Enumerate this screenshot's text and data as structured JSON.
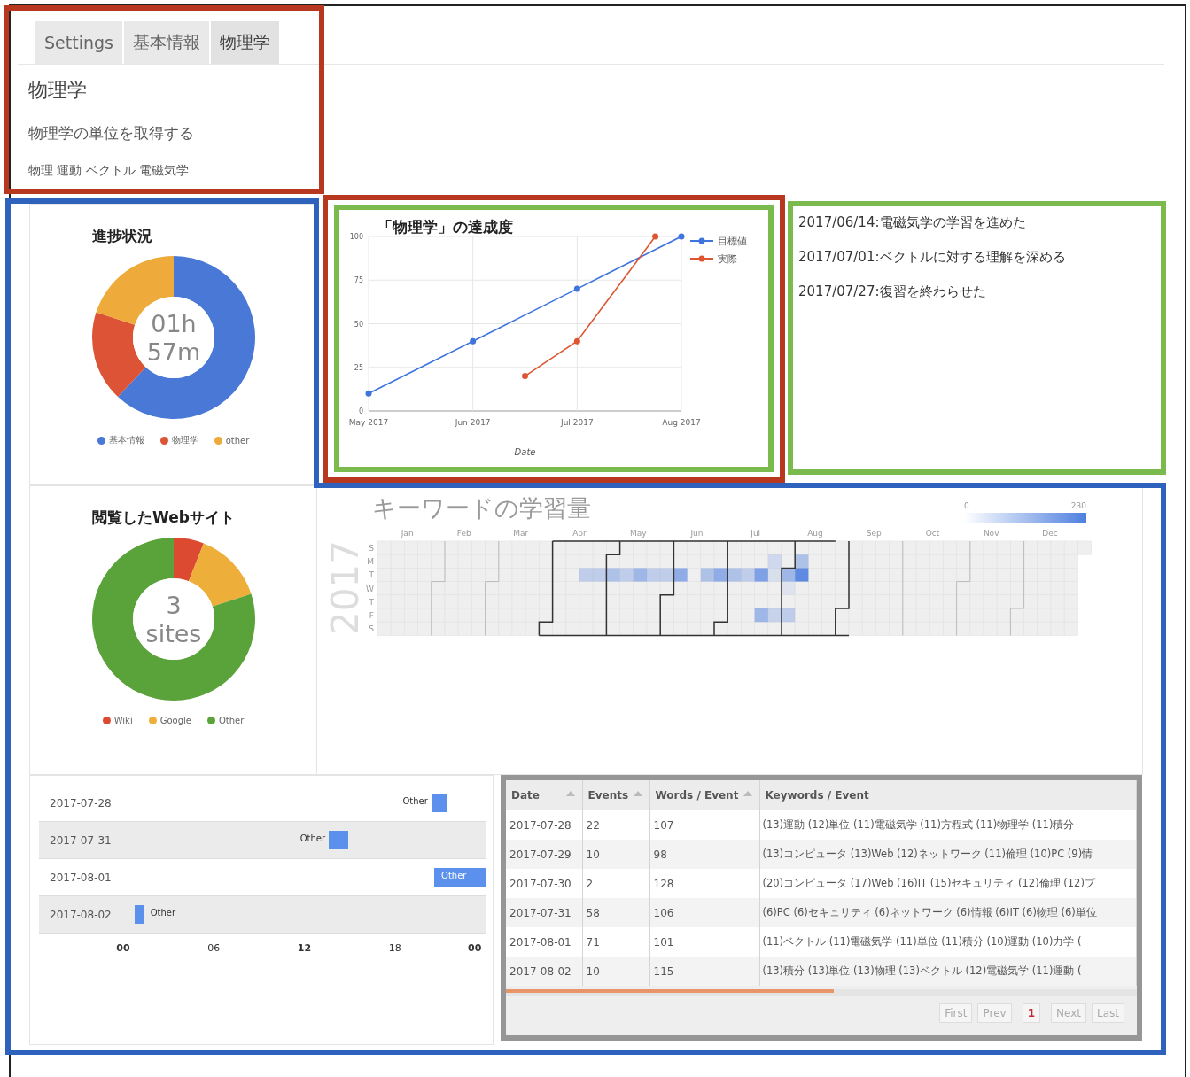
{
  "tabs": [
    {
      "label": "Settings",
      "selected": false
    },
    {
      "label": "基本情報",
      "selected": false
    },
    {
      "label": "物理学",
      "selected": true
    }
  ],
  "subject": {
    "title": "物理学",
    "goal": "物理学の単位を取得する",
    "tags": "物理 運動 ベクトル 電磁気学"
  },
  "progress": {
    "title": "進捗状況",
    "center": [
      "01h",
      "57m"
    ],
    "legend": [
      {
        "label": "基本情報",
        "color": "#4a78d6"
      },
      {
        "label": "物理学",
        "color": "#dc5435"
      },
      {
        "label": "other",
        "color": "#eeaa3a"
      }
    ]
  },
  "achievement_chart": {
    "chart_data": {
      "type": "line",
      "title": "「物理学」の達成度",
      "xlabel": "Date",
      "grid": true,
      "legend": true,
      "categories": [
        "May 2017",
        null,
        null,
        null,
        "Jun 2017",
        null,
        null,
        null,
        "Jul 2017",
        null,
        null,
        null,
        "Aug 2017"
      ],
      "yticks": [
        {
          "value": 0,
          "label": "0"
        },
        {
          "value": 25,
          "label": "25"
        },
        {
          "value": 50,
          "label": "50"
        },
        {
          "value": 75,
          "label": "75"
        },
        {
          "value": 100,
          "label": "100"
        }
      ],
      "ylim": [
        0,
        100
      ],
      "series": [
        {
          "name": "目標値",
          "color": "#3f74dc",
          "values": [
            10,
            17.5,
            25,
            32.5,
            40,
            47.5,
            55,
            62.5,
            70,
            77.5,
            85,
            92.5,
            100
          ]
        },
        {
          "name": "実際",
          "color": "#de5631",
          "values": [
            null,
            null,
            null,
            null,
            null,
            null,
            20,
            30,
            40,
            60,
            80,
            100,
            null
          ]
        }
      ]
    }
  },
  "notes": [
    "2017/06/14:電磁気学の学習を進めた",
    "2017/07/01:ベクトルに対する理解を深める",
    "2017/07/27:復習を終わらせた"
  ],
  "sites": {
    "title": "閲覧したWebサイト",
    "center": [
      "3",
      "sites"
    ],
    "legend": [
      {
        "label": "Wiki",
        "color": "#dc4a32"
      },
      {
        "label": "Google",
        "color": "#eeae3a"
      },
      {
        "label": "Other",
        "color": "#5aa33a"
      }
    ]
  },
  "heatmap": {
    "title": "キーワードの学習量",
    "year": "2017",
    "months": [
      "Jan",
      "Feb",
      "Mar",
      "Apr",
      "May",
      "Jun",
      "Jul",
      "Aug",
      "Sep",
      "Oct",
      "Nov",
      "Dec"
    ],
    "days": [
      "S",
      "M",
      "T",
      "W",
      "T",
      "F",
      "S"
    ],
    "scale": [
      "0",
      "230"
    ]
  },
  "timeline": {
    "rows": [
      {
        "date": "2017-07-28",
        "bar_label": "Other"
      },
      {
        "date": "2017-07-31",
        "bar_label": "Other"
      },
      {
        "date": "2017-08-01",
        "bar_label": "Other"
      },
      {
        "date": "2017-08-02",
        "bar_label": "Other"
      }
    ],
    "axis_labels": [
      "00",
      "06",
      "12",
      "18",
      "00"
    ]
  },
  "table": {
    "columns": [
      {
        "label": "Date",
        "sortable": true
      },
      {
        "label": "Events",
        "sortable": true
      },
      {
        "label": "Words / Event",
        "sortable": true
      },
      {
        "label": "Keywords / Event",
        "sortable": false
      }
    ],
    "rows": [
      [
        "2017-07-28",
        "22",
        "107",
        "(13)運動 (12)単位 (11)電磁気学 (11)方程式 (11)物理学 (11)積分"
      ],
      [
        "2017-07-29",
        "10",
        "98",
        "(13)コンピュータ (13)Web (12)ネットワーク (11)倫理 (10)PC (9)情"
      ],
      [
        "2017-07-30",
        "2",
        "128",
        "(20)コンピュータ (17)Web (16)IT (15)セキュリティ (12)倫理 (12)プ"
      ],
      [
        "2017-07-31",
        "58",
        "106",
        "(6)PC (6)セキュリティ (6)ネットワーク (6)情報 (6)IT (6)物理 (6)単位"
      ],
      [
        "2017-08-01",
        "71",
        "101",
        "(11)ベクトル (11)電磁気学 (11)単位 (11)積分 (10)運動 (10)力学 ("
      ],
      [
        "2017-08-02",
        "10",
        "115",
        "(13)積分 (13)単位 (13)物理 (13)ベクトル (12)電磁気学 (11)運動 ("
      ]
    ],
    "pager": [
      {
        "label": "First",
        "kind": "nav",
        "disabled": true
      },
      {
        "label": "Prev",
        "kind": "nav",
        "disabled": true
      },
      {
        "label": "1",
        "kind": "page",
        "selected": true
      },
      {
        "label": "Next",
        "kind": "nav",
        "disabled": true
      },
      {
        "label": "Last",
        "kind": "nav",
        "disabled": true
      }
    ]
  },
  "highlight_frames": [
    {
      "color": "#b8381f"
    },
    {
      "color": "#2f62bd"
    },
    {
      "color": "#b8381f"
    },
    {
      "color": "#7bbb4e"
    },
    {
      "color": "#7bbb4e"
    }
  ]
}
